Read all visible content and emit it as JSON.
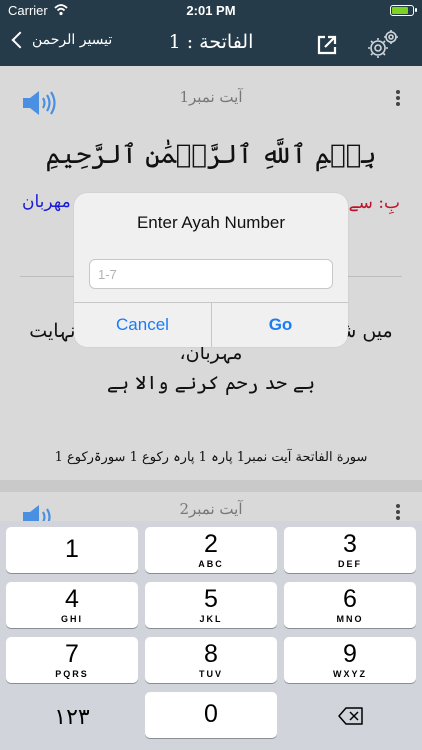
{
  "status_bar": {
    "carrier": "Carrier",
    "time": "2:01 PM"
  },
  "nav": {
    "back_label": "تیسیر الرحمن",
    "title": "الفاتحة : 1"
  },
  "ayah1": {
    "label": "آیت نمبر1",
    "arabic": "بِسۡمِ ٱللَّهِ ٱلرَّحۡمَٰنِ ٱلرَّحِيمِ",
    "word_left": "مهربان",
    "word_right": "بِ: سے",
    "urdu_line1": "میں شروع کرتا ہوں اللہ کے نام سے جو نہایت مہربان،",
    "urdu_line2": "بے حد رحم کرنے والا ہے",
    "info": "سورة الفاتحة آیت نمبر1   پارہ 1 پارہ رکوع 1  سورۃرکوع 1"
  },
  "ayah2": {
    "label": "آیت نمبر2"
  },
  "alert": {
    "title": "Enter Ayah Number",
    "placeholder": "1-7",
    "value": "",
    "cancel": "Cancel",
    "go": "Go"
  },
  "keypad": {
    "keys": [
      {
        "num": "1",
        "letters": ""
      },
      {
        "num": "2",
        "letters": "ABC"
      },
      {
        "num": "3",
        "letters": "DEF"
      },
      {
        "num": "4",
        "letters": "GHI"
      },
      {
        "num": "5",
        "letters": "JKL"
      },
      {
        "num": "6",
        "letters": "MNO"
      },
      {
        "num": "7",
        "letters": "PQRS"
      },
      {
        "num": "8",
        "letters": "TUV"
      },
      {
        "num": "9",
        "letters": "WXYZ"
      },
      {
        "num": "0",
        "letters": ""
      }
    ],
    "switch_label": "١٢٣"
  },
  "colors": {
    "nav": "#263b4a",
    "accent": "#1a7cf5",
    "word_blue": "#1a1ad6",
    "word_red": "#c0112b"
  },
  "icons": [
    "wifi-icon",
    "battery-icon",
    "chevron-left-icon",
    "share-icon",
    "settings-gear-icon",
    "speaker-icon",
    "more-vertical-icon",
    "delete-backspace-icon"
  ]
}
